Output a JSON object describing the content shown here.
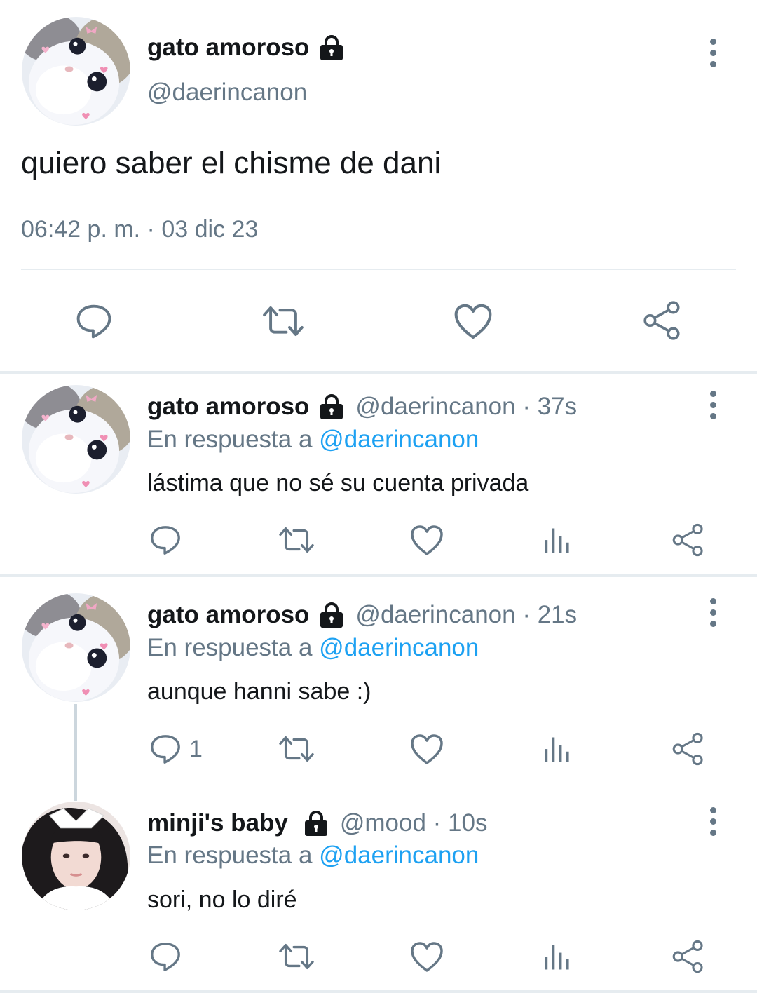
{
  "main_tweet": {
    "name": "gato amoroso",
    "handle": "@daerincanon",
    "text": "quiero saber el chisme de dani",
    "timestamp": "06:42 p. m. · 03 dic 23",
    "locked": true
  },
  "replies": [
    {
      "name": "gato amoroso",
      "meta": "@daerincanon · 37s",
      "reply_label": "En respuesta a",
      "reply_mention": "@daerincanon",
      "text": "lástima que no sé su cuenta privada",
      "reply_count": ""
    },
    {
      "name": "gato amoroso",
      "meta": "@daerincanon · 21s",
      "reply_label": "En respuesta a",
      "reply_mention": "@daerincanon",
      "text": "aunque hanni sabe :)",
      "reply_count": "1"
    },
    {
      "name": "minji's baby",
      "meta": "@mood · 10s",
      "reply_label": "En respuesta a",
      "reply_mention": "@daerincanon",
      "text": "sori, no lo diré",
      "reply_count": ""
    }
  ],
  "icons": {
    "reply": "reply-icon",
    "retweet": "retweet-icon",
    "like": "heart-icon",
    "views": "views-icon",
    "share": "share-icon",
    "more": "more-vertical-icon",
    "lock": "lock-icon"
  },
  "colors": {
    "text": "#14171a",
    "secondary": "#657786",
    "mention": "#1da1f2",
    "divider": "#e6ecf0"
  }
}
